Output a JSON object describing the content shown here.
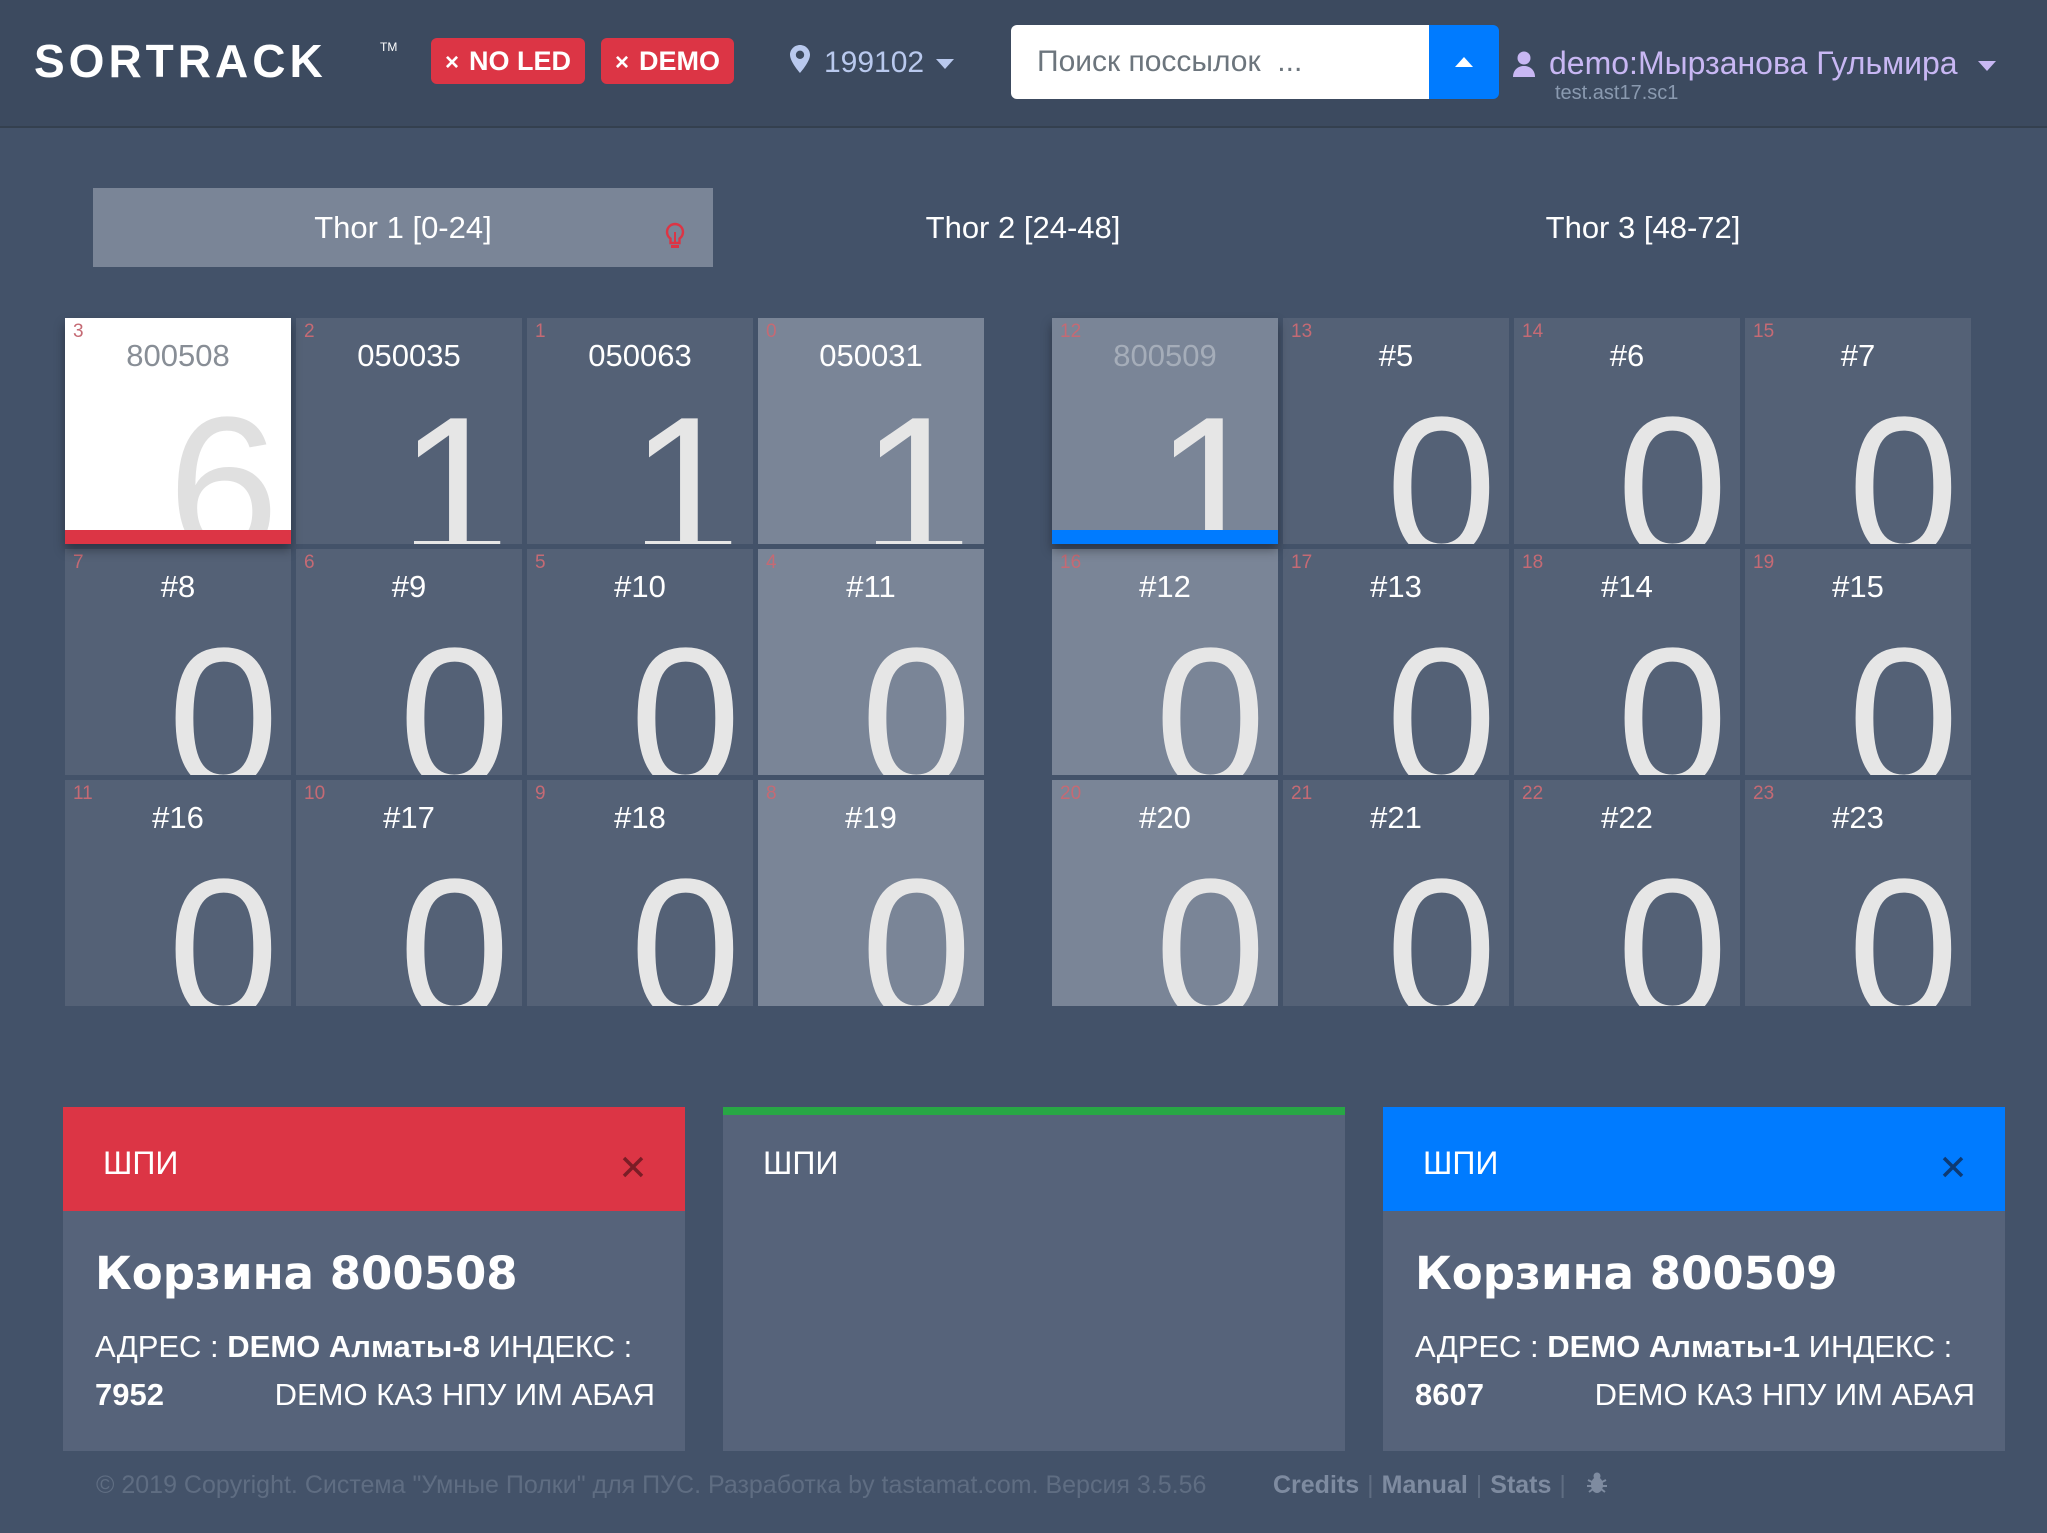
{
  "app": {
    "logo": "SORTRACK",
    "tm": "TM",
    "badges": [
      {
        "label": "NO LED",
        "x": "×"
      },
      {
        "label": "DEMO",
        "x": "×"
      }
    ],
    "location": "199102",
    "search_placeholder": "Поиск поссылок  ...",
    "user_name": "demo:Мырзанова Гульмира",
    "user_sub": "test.ast17.sc1"
  },
  "tabs": [
    {
      "label": "Thor 1 [0-24]",
      "active": true
    },
    {
      "label": "Thor 2 [24-48]",
      "active": false
    },
    {
      "label": "Thor 3 [48-72]",
      "active": false
    }
  ],
  "left_grid": [
    {
      "idx": "3",
      "label": "800508",
      "count": "6"
    },
    {
      "idx": "2",
      "label": "050035",
      "count": "1"
    },
    {
      "idx": "1",
      "label": "050063",
      "count": "1"
    },
    {
      "idx": "0",
      "label": "050031",
      "count": "1"
    },
    {
      "idx": "7",
      "label": "#8",
      "count": "0"
    },
    {
      "idx": "6",
      "label": "#9",
      "count": "0"
    },
    {
      "idx": "5",
      "label": "#10",
      "count": "0"
    },
    {
      "idx": "4",
      "label": "#11",
      "count": "0"
    },
    {
      "idx": "11",
      "label": "#16",
      "count": "0"
    },
    {
      "idx": "10",
      "label": "#17",
      "count": "0"
    },
    {
      "idx": "9",
      "label": "#18",
      "count": "0"
    },
    {
      "idx": "8",
      "label": "#19",
      "count": "0"
    }
  ],
  "right_grid": [
    {
      "idx": "12",
      "label": "800509",
      "count": "1"
    },
    {
      "idx": "13",
      "label": "#5",
      "count": "0"
    },
    {
      "idx": "14",
      "label": "#6",
      "count": "0"
    },
    {
      "idx": "15",
      "label": "#7",
      "count": "0"
    },
    {
      "idx": "16",
      "label": "#12",
      "count": "0"
    },
    {
      "idx": "17",
      "label": "#13",
      "count": "0"
    },
    {
      "idx": "18",
      "label": "#14",
      "count": "0"
    },
    {
      "idx": "19",
      "label": "#15",
      "count": "0"
    },
    {
      "idx": "20",
      "label": "#20",
      "count": "0"
    },
    {
      "idx": "21",
      "label": "#21",
      "count": "0"
    },
    {
      "idx": "22",
      "label": "#22",
      "count": "0"
    },
    {
      "idx": "23",
      "label": "#23",
      "count": "0"
    }
  ],
  "panels": [
    {
      "header": "ШПИ",
      "color": "#dc3545",
      "close": "×",
      "title": "Корзина 800508",
      "addr_label": "АДРЕС : ",
      "addr_value": "DEMO Алматы-8",
      "index_label": " ИНДЕКС :",
      "index_value": "7952",
      "dest": "DEMO КАЗ НПУ ИМ АБАЯ"
    },
    {
      "header": "ШПИ",
      "color": "#28a745"
    },
    {
      "header": "ШПИ",
      "color": "#007bff",
      "close": "×",
      "title": "Корзина 800509",
      "addr_label": "АДРЕС : ",
      "addr_value": "DEMO Алматы-1",
      "index_label": " ИНДЕКС :",
      "index_value": "8607",
      "dest": "DEMO КАЗ НПУ ИМ АБАЯ"
    }
  ],
  "footer": {
    "copyright": "© 2019 Copyright. Система \"Умные Полки\" для ПУС. Разработка by tastamat.com. Версия 3.5.56",
    "links": [
      "Credits",
      "Manual",
      "Stats"
    ],
    "sep": "|"
  },
  "colors": {
    "accent_red": "#dc3545",
    "accent_blue": "#007bff",
    "accent_green": "#28a745",
    "background": "#435269"
  }
}
